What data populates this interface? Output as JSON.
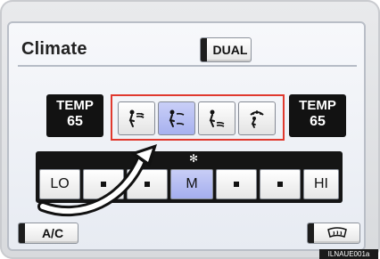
{
  "header": {
    "title": "Climate",
    "dual_label": "DUAL"
  },
  "temp": {
    "left_label": "TEMP",
    "left_value": "65",
    "right_label": "TEMP",
    "right_value": "65"
  },
  "modes": [
    "face-vent-icon",
    "bi-level-icon",
    "foot-vent-icon",
    "foot-defrost-icon"
  ],
  "selected_mode_index": 1,
  "fan": {
    "lo_label": "LO",
    "m_label": "M",
    "hi_label": "HI",
    "icon": "fan-icon",
    "selected_level": "M"
  },
  "bottom": {
    "ac_label": "A/C",
    "defrost_icon": "rear-defrost-icon"
  },
  "footer_code": "ILNAUE001a",
  "colors": {
    "highlight_frame": "#e0392e",
    "selected_fill": "#b7bff2",
    "panel_black": "#151515"
  }
}
